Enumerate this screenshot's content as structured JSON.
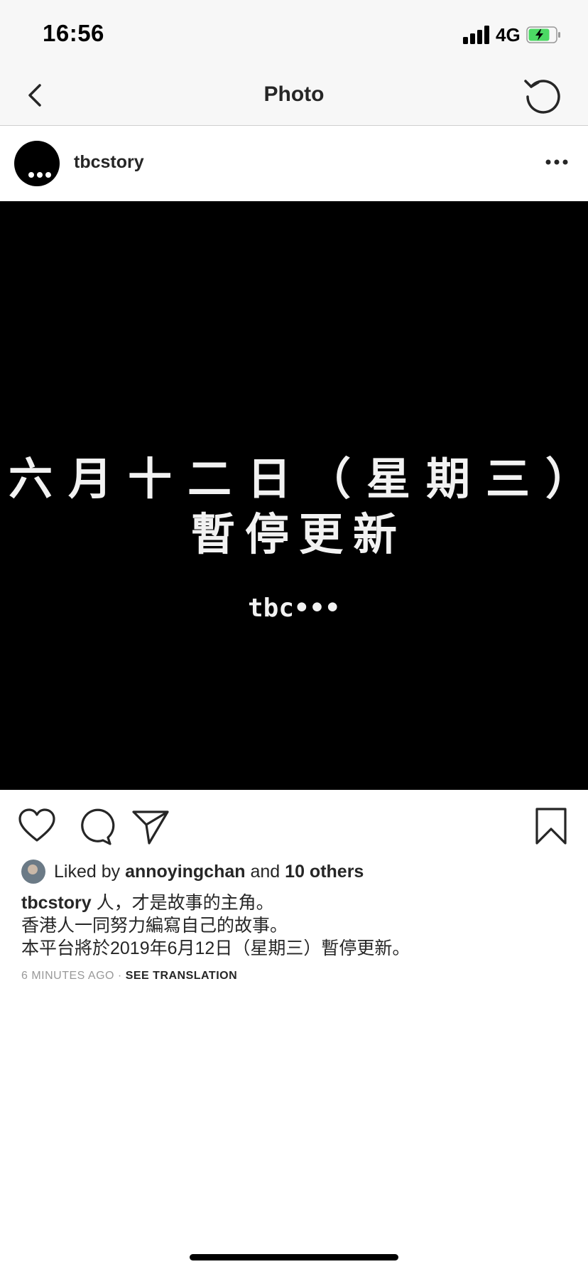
{
  "status_bar": {
    "time": "16:56",
    "network": "4G",
    "battery_color": "#4cd964"
  },
  "nav": {
    "title": "Photo",
    "back_icon": "chevron-left-icon",
    "reload_icon": "reload-icon"
  },
  "post": {
    "username": "tbcstory",
    "image": {
      "line1": "六月十二日（星期三）",
      "line2": "暫停更新",
      "mark": "tbc•••"
    },
    "likes": {
      "prefix": "Liked by",
      "user": "annoyingchan",
      "middle": "and",
      "others": "10 others"
    },
    "caption": {
      "username": "tbcstory",
      "line1": "人，才是故事的主角。",
      "line2": "香港人一同努力編寫自己的故事。",
      "line3": "本平台將於2019年6月12日（星期三）暫停更新。"
    },
    "timestamp": "6 MINUTES AGO",
    "separator": "·",
    "see_translation": "SEE TRANSLATION"
  }
}
